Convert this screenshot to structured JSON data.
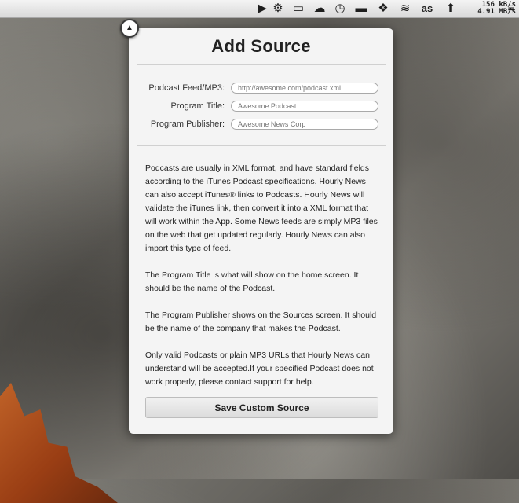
{
  "menubar": {
    "icons": [
      "play-triangle-icon",
      "gear-cog-icon",
      "display-icon",
      "cloud-icon",
      "clock-icon",
      "basket-icon",
      "dropbox-icon",
      "wifi-icon",
      "lastfm-icon",
      "upload-arrow-icon",
      "menu-extra-icon"
    ],
    "speed_up": "156 kB/s",
    "speed_down": "4.91 MB/s"
  },
  "dialog": {
    "title": "Add Source",
    "fields": [
      {
        "label": "Podcast Feed/MP3:",
        "placeholder": "http://awesome.com/podcast.xml"
      },
      {
        "label": "Program Title:",
        "placeholder": "Awesome Podcast"
      },
      {
        "label": "Program Publisher:",
        "placeholder": "Awesome News Corp"
      }
    ],
    "paragraphs": [
      "Podcasts are usually in XML format, and have standard fields according to the iTunes Podcast specifications. Hourly News can also accept iTunes® links to Podcasts. Hourly News will validate the iTunes link, then convert it into a XML format that will work within the App. Some News feeds are simply MP3 files on the web that get updated regularly. Hourly News can also import this type of feed.",
      "The Program Title is what will show on the home screen. It should be the name of the Podcast.",
      "The Program Publisher shows on the Sources screen. It should be the name of the company that makes the Podcast.",
      "Only valid Podcasts or plain MP3 URLs that Hourly News can understand will be accepted.If your specified Podcast does not work properly, please contact support for help."
    ],
    "save_label": "Save Custom Source"
  }
}
